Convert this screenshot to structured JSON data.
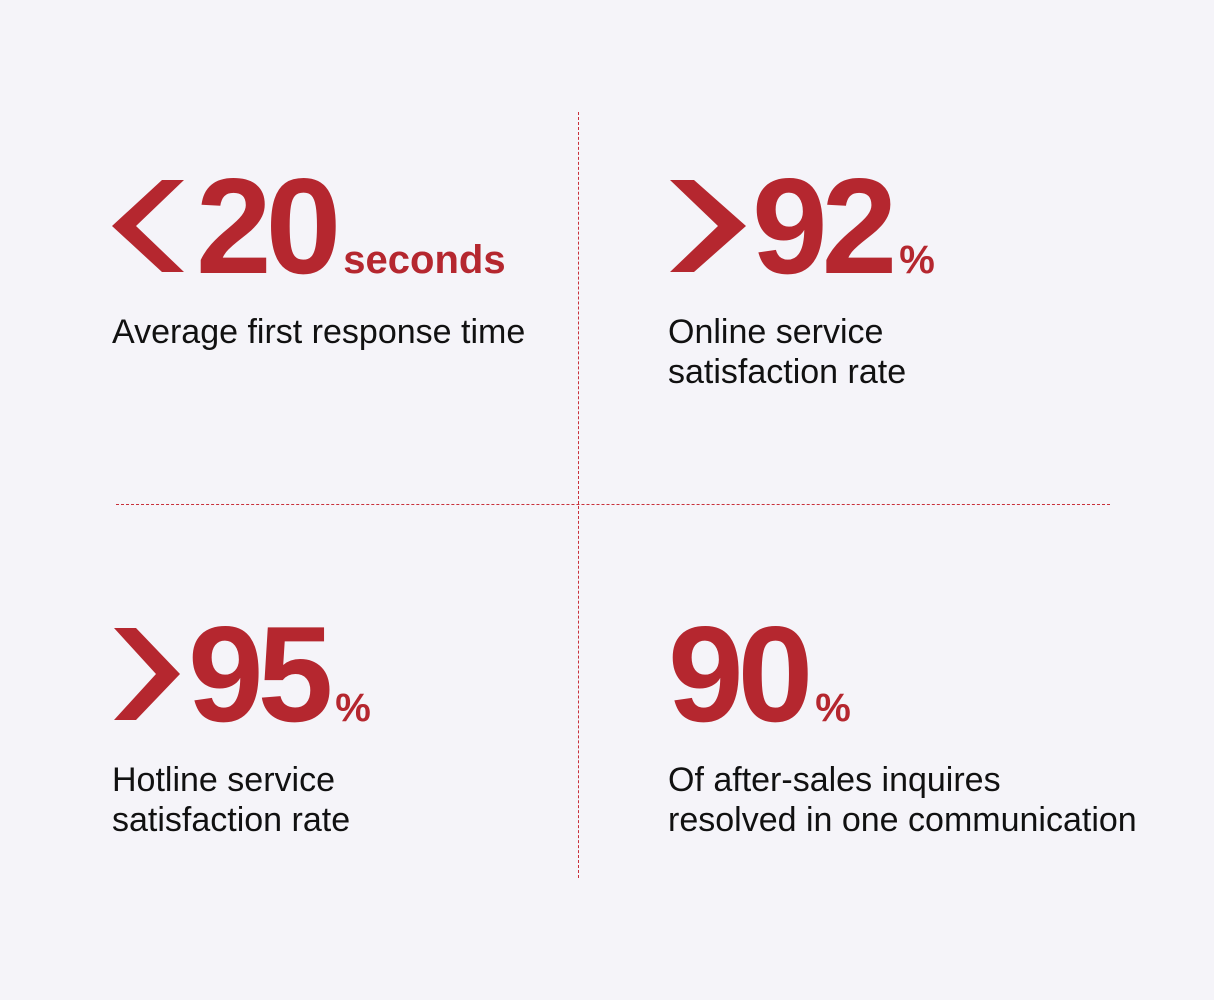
{
  "colors": {
    "accent": "#b5272f",
    "background": "#f5f4f9",
    "text": "#111111"
  },
  "stats": [
    {
      "comparator_icon": "less-than-chevron-icon",
      "value": "20",
      "unit": "seconds",
      "description": "Average first response time"
    },
    {
      "comparator_icon": "greater-than-chevron-icon",
      "value": "92",
      "unit": "%",
      "description_lines": [
        "Online service",
        "satisfaction rate"
      ]
    },
    {
      "comparator_icon": "greater-than-chevron-icon",
      "value": "95",
      "unit": "%",
      "description_lines": [
        "Hotline service",
        "satisfaction rate"
      ]
    },
    {
      "value": "90",
      "unit": "%",
      "description_lines": [
        "Of after-sales inquires",
        "resolved in one communication"
      ]
    }
  ]
}
